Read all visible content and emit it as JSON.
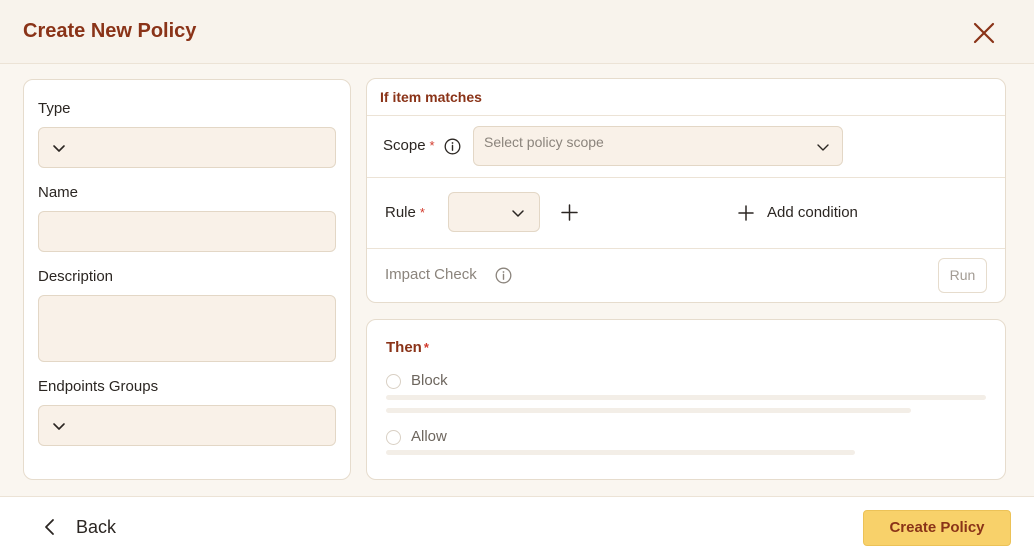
{
  "header": {
    "title": "Create New Policy",
    "close_icon": "close-icon"
  },
  "form": {
    "type_label": "Type",
    "name_label": "Name",
    "description_label": "Description",
    "endpoints_label": "Endpoints Groups",
    "type_value": "",
    "name_value": "",
    "description_value": "",
    "endpoints_value": ""
  },
  "match": {
    "title": "If item matches",
    "scope_label": "Scope",
    "scope_placeholder": "Select policy scope",
    "rule_label": "Rule",
    "required_mark": "*",
    "add_condition_label": "Add condition",
    "impact_check_label": "Impact Check",
    "run_label": "Run"
  },
  "then": {
    "title": "Then",
    "required_mark": "*",
    "options": [
      {
        "label": "Block",
        "selected": false
      },
      {
        "label": "Allow",
        "selected": false
      }
    ]
  },
  "footer": {
    "back_label": "Back",
    "create_label": "Create Policy"
  },
  "colors": {
    "accent_text": "#8a3318",
    "primary_button": "#f8d16a",
    "required": "#d23a2c",
    "input_bg": "#f9f1e8",
    "header_bg": "#f8f3ec"
  }
}
